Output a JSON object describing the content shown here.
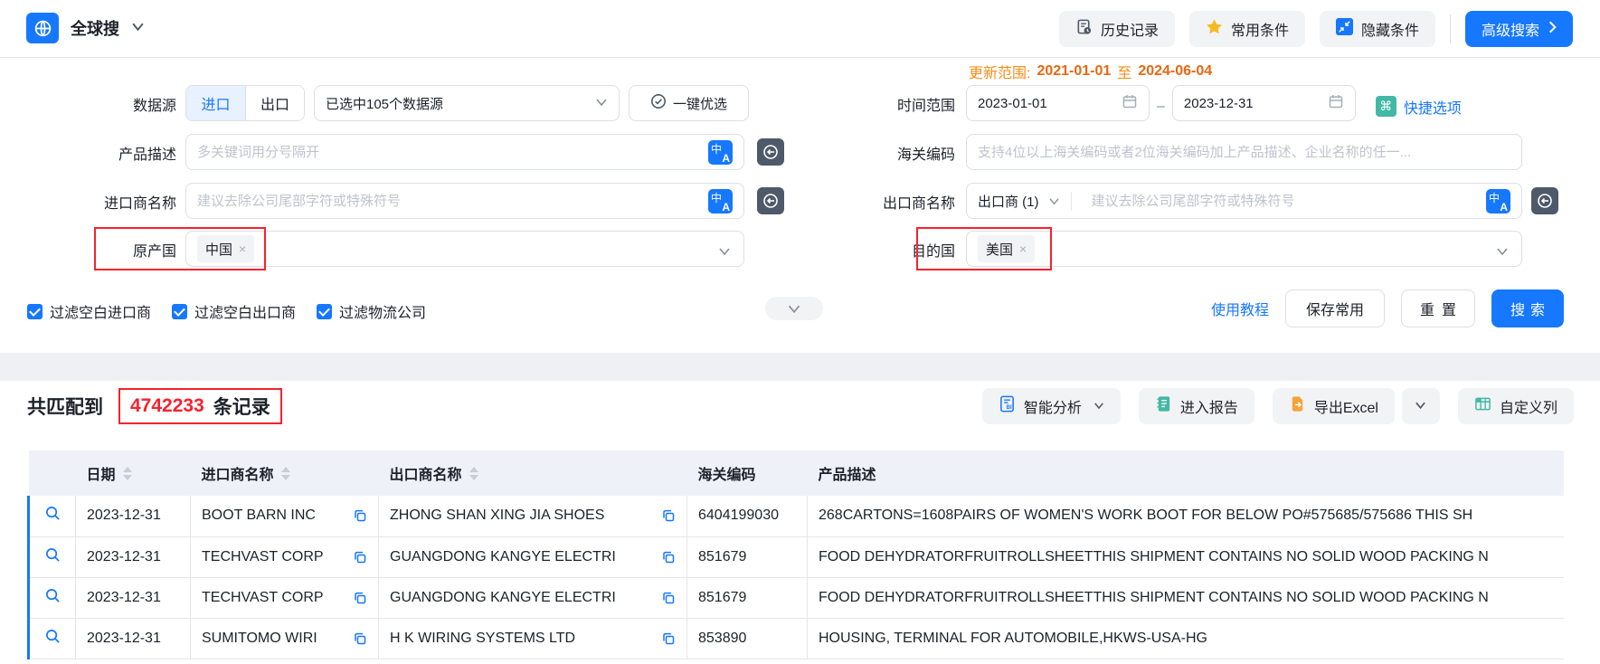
{
  "colors": {
    "primary": "#1677ff",
    "annotation_red": "#f5222d",
    "count_red": "#f5222d",
    "orange_label": "#fa8c16",
    "orange_date": "#e8670f",
    "teal_icon": "#42b8a5",
    "gold_star": "#f7ba1e",
    "orange_excel_icon": "#f5a43c",
    "dark_icon": "#4e5969"
  },
  "icons": {
    "translate_glyph_top": "中",
    "translate_glyph_bottom": "A",
    "shortcut_glyph": "⌘",
    "bi_glyph": "BI",
    "tag_close_glyph": "×",
    "date_separator": "–"
  },
  "topbar": {
    "app_title": "全球搜",
    "history_label": "历史记录",
    "favorites_label": "常用条件",
    "hide_label": "隐藏条件",
    "advanced_label": "高级搜索"
  },
  "form": {
    "data_source": {
      "label": "数据源",
      "import_tab": "进口",
      "export_tab": "出口",
      "selected_text": "已选中105个数据源",
      "optimize_label": "一键优选"
    },
    "update_range": {
      "label": "更新范围:",
      "start": "2021-01-01",
      "to": "至",
      "end": "2024-06-04"
    },
    "time_range": {
      "label": "时间范围",
      "start": "2023-01-01",
      "end": "2023-12-31",
      "shortcut_label": "快捷选项"
    },
    "product_desc": {
      "label": "产品描述",
      "placeholder": "多关键词用分号隔开"
    },
    "hs_code": {
      "label": "海关编码",
      "placeholder": "支持4位以上海关编码或者2位海关编码加上产品描述、企业名称的任一..."
    },
    "importer": {
      "label": "进口商名称",
      "placeholder": "建议去除公司尾部字符或特殊符号"
    },
    "exporter": {
      "label": "出口商名称",
      "type_selector": "出口商 (1)",
      "placeholder": "建议去除公司尾部字符或特殊符号"
    },
    "origin_country": {
      "label": "原产国",
      "tag": "中国"
    },
    "dest_country": {
      "label": "目的国",
      "tag": "美国"
    },
    "filters": [
      {
        "label": "过滤空白进口商",
        "checked": true
      },
      {
        "label": "过滤空白出口商",
        "checked": true
      },
      {
        "label": "过滤物流公司",
        "checked": true
      }
    ],
    "tutorial_label": "使用教程",
    "save_label": "保存常用",
    "reset_label": "重置",
    "search_label": "搜索"
  },
  "results": {
    "summary": {
      "prefix": "共匹配到",
      "count": "4742233",
      "suffix": "条记录"
    },
    "toolbar": {
      "analysis": "智能分析",
      "report": "进入报告",
      "export": "导出Excel",
      "columns": "自定义列"
    },
    "table": {
      "columns": [
        "日期",
        "进口商名称",
        "出口商名称",
        "海关编码",
        "产品描述"
      ],
      "rows": [
        {
          "date": "2023-12-31",
          "importer": "BOOT BARN INC",
          "exporter": "ZHONG SHAN XING JIA SHOES",
          "hs_code": "6404199030",
          "description": "268CARTONS=1608PAIRS OF WOMEN'S WORK BOOT FOR BELOW PO#575685/575686 THIS SH"
        },
        {
          "date": "2023-12-31",
          "importer": "TECHVAST CORP",
          "exporter": "GUANGDONG KANGYE ELECTRI",
          "hs_code": "851679",
          "description": "FOOD DEHYDRATORFRUITROLLSHEETTHIS SHIPMENT CONTAINS NO SOLID WOOD PACKING N"
        },
        {
          "date": "2023-12-31",
          "importer": "TECHVAST CORP",
          "exporter": "GUANGDONG KANGYE ELECTRI",
          "hs_code": "851679",
          "description": "FOOD DEHYDRATORFRUITROLLSHEETTHIS SHIPMENT CONTAINS NO SOLID WOOD PACKING N"
        },
        {
          "date": "2023-12-31",
          "importer": "SUMITOMO WIRI",
          "exporter": "H K WIRING SYSTEMS LTD",
          "hs_code": "853890",
          "description": "HOUSING, TERMINAL FOR AUTOMOBILE,HKWS-USA-HG"
        }
      ]
    }
  }
}
